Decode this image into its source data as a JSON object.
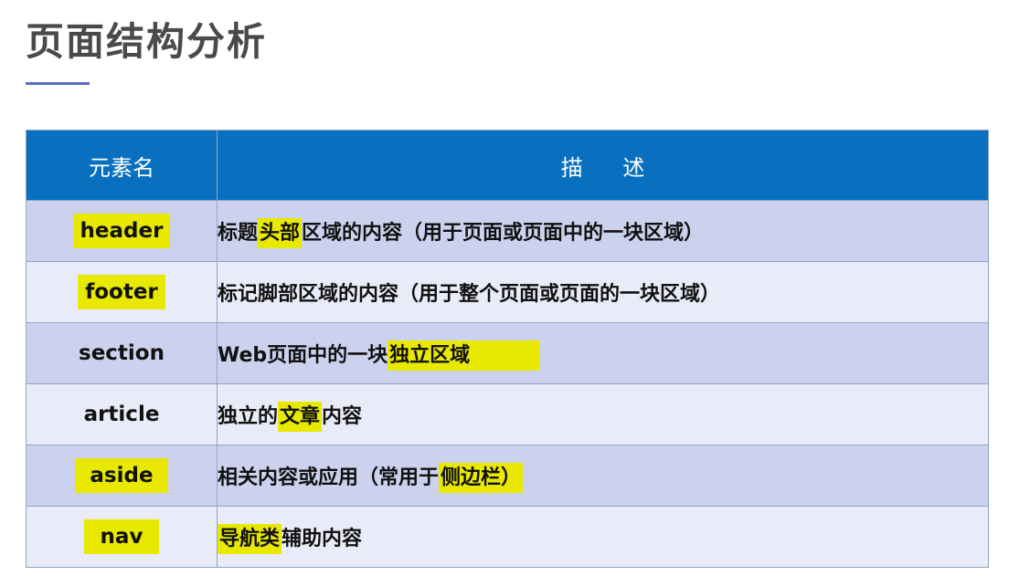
{
  "page": {
    "title": "页面结构分析"
  },
  "table": {
    "headers": {
      "name": "元素名",
      "description": "描 述"
    },
    "rows": [
      {
        "name": "header",
        "desc_parts": [
          "标题",
          "头部",
          "区域的内容（用于页面或页面中的一块区域）"
        ]
      },
      {
        "name": "footer",
        "desc_parts": [
          "标记脚部区域的内容（用于整个页面或页面的一块区域）"
        ]
      },
      {
        "name": "section",
        "desc_parts": [
          "Web页面中的一块",
          "独立区域",
          ""
        ]
      },
      {
        "name": "article",
        "desc_parts": [
          "独立的",
          "文章",
          "内容"
        ]
      },
      {
        "name": "aside",
        "desc_parts": [
          "相关内容或应用（常用于",
          "侧边栏）",
          ""
        ]
      },
      {
        "name": "nav",
        "desc_parts": [
          "",
          "导航类",
          "辅助内容"
        ]
      }
    ]
  },
  "colors": {
    "header_bg": "#0870bf",
    "row_dark": "#ccd2ee",
    "row_light": "#e9ecf8",
    "highlight": "#e8e800"
  }
}
